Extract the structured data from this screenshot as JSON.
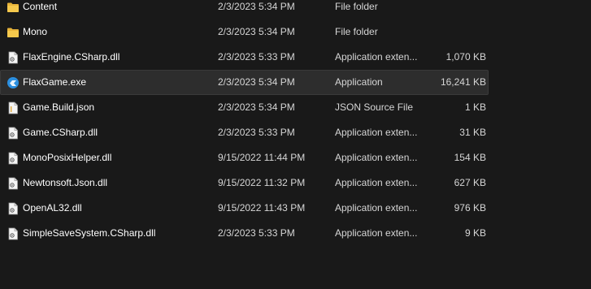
{
  "files": [
    {
      "name": "Content",
      "date": "2/3/2023 5:34 PM",
      "type": "File folder",
      "size": "",
      "icon": "folder-icon",
      "selected": false
    },
    {
      "name": "Mono",
      "date": "2/3/2023 5:34 PM",
      "type": "File folder",
      "size": "",
      "icon": "folder-icon",
      "selected": false
    },
    {
      "name": "FlaxEngine.CSharp.dll",
      "date": "2/3/2023 5:33 PM",
      "type": "Application exten...",
      "size": "1,070 KB",
      "icon": "dll-file-icon",
      "selected": false
    },
    {
      "name": "FlaxGame.exe",
      "date": "2/3/2023 5:34 PM",
      "type": "Application",
      "size": "16,241 KB",
      "icon": "flax-app-icon",
      "selected": true
    },
    {
      "name": "Game.Build.json",
      "date": "2/3/2023 5:34 PM",
      "type": "JSON Source File",
      "size": "1 KB",
      "icon": "json-file-icon",
      "selected": false
    },
    {
      "name": "Game.CSharp.dll",
      "date": "2/3/2023 5:33 PM",
      "type": "Application exten...",
      "size": "31 KB",
      "icon": "dll-file-icon",
      "selected": false
    },
    {
      "name": "MonoPosixHelper.dll",
      "date": "9/15/2022 11:44 PM",
      "type": "Application exten...",
      "size": "154 KB",
      "icon": "dll-file-icon",
      "selected": false
    },
    {
      "name": "Newtonsoft.Json.dll",
      "date": "9/15/2022 11:32 PM",
      "type": "Application exten...",
      "size": "627 KB",
      "icon": "dll-file-icon",
      "selected": false
    },
    {
      "name": "OpenAL32.dll",
      "date": "9/15/2022 11:43 PM",
      "type": "Application exten...",
      "size": "976 KB",
      "icon": "dll-file-icon",
      "selected": false
    },
    {
      "name": "SimpleSaveSystem.CSharp.dll",
      "date": "2/3/2023 5:33 PM",
      "type": "Application exten...",
      "size": "9 KB",
      "icon": "dll-file-icon",
      "selected": false
    }
  ],
  "colors": {
    "background": "#191919",
    "selected_row": "#2d2d2d",
    "folder": "#f0c040",
    "app_icon": "#2b8fe0"
  }
}
